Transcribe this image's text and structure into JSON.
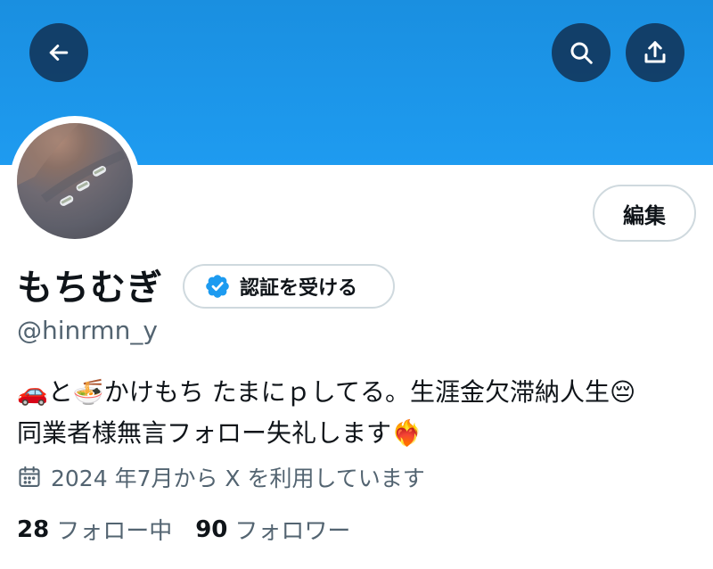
{
  "profile": {
    "display_name": "もちむぎ",
    "handle": "@hinrmn_y",
    "verify_label": "認証を受ける",
    "edit_label": "編集",
    "bio": {
      "line1": "🚗と🍜かけもち たまにｐしてる。生涯金欠滞納人生😔",
      "line2": "同業者様無言フォロー失礼します❤️‍🔥"
    },
    "joined": "2024 年7月から X を利用しています",
    "stats": {
      "following_count": "28",
      "following_label": "フォロー中",
      "followers_count": "90",
      "followers_label": "フォロワー"
    }
  },
  "icons": {
    "back": "arrow-left-icon",
    "search": "search-icon",
    "share": "share-icon",
    "verified": "verified-badge-icon",
    "calendar": "calendar-icon"
  },
  "colors": {
    "banner": "#1e9bf0",
    "verified_blue": "#1d9bf0",
    "text_primary": "#0f1419",
    "text_secondary": "#536471",
    "border": "#cfd9de"
  }
}
